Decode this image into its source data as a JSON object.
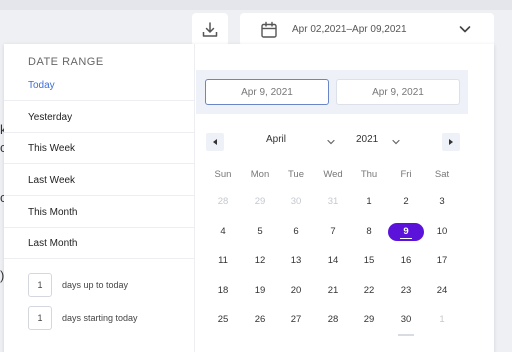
{
  "toolbar": {
    "download_icon": "download-icon",
    "range_icon": "calendar-icon",
    "range_text": "Apr 02,2021–Apr 09,2021",
    "range_chevron_icon": "chevron-down-icon"
  },
  "panel": {
    "title": "DATE RANGE",
    "presets": [
      {
        "label": "Today"
      },
      {
        "label": "Yesterday"
      },
      {
        "label": "This Week"
      },
      {
        "label": "Last Week"
      },
      {
        "label": "This Month"
      },
      {
        "label": "Last Month"
      }
    ],
    "days_up_to_today": {
      "value": "1",
      "label": "days up to today"
    },
    "days_starting_today": {
      "value": "1",
      "label": "days starting today"
    }
  },
  "calendar": {
    "start_date": "Apr 9, 2021",
    "end_date": "Apr 9, 2021",
    "month": "April",
    "year": "2021",
    "weekdays": [
      "Sun",
      "Mon",
      "Tue",
      "Wed",
      "Thu",
      "Fri",
      "Sat"
    ],
    "weeks": [
      [
        "28",
        "29",
        "30",
        "31",
        "1",
        "2",
        "3"
      ],
      [
        "4",
        "5",
        "6",
        "7",
        "8",
        "9",
        "10"
      ],
      [
        "11",
        "12",
        "13",
        "14",
        "15",
        "16",
        "17"
      ],
      [
        "18",
        "19",
        "20",
        "21",
        "22",
        "23",
        "24"
      ],
      [
        "25",
        "26",
        "27",
        "28",
        "29",
        "30",
        "1"
      ]
    ],
    "selected_day": "9",
    "colors": {
      "accent": "#5c13d9",
      "link": "#3d6fdb"
    }
  },
  "background": {
    "fragments": [
      "k",
      "c",
      "c",
      ")"
    ]
  }
}
